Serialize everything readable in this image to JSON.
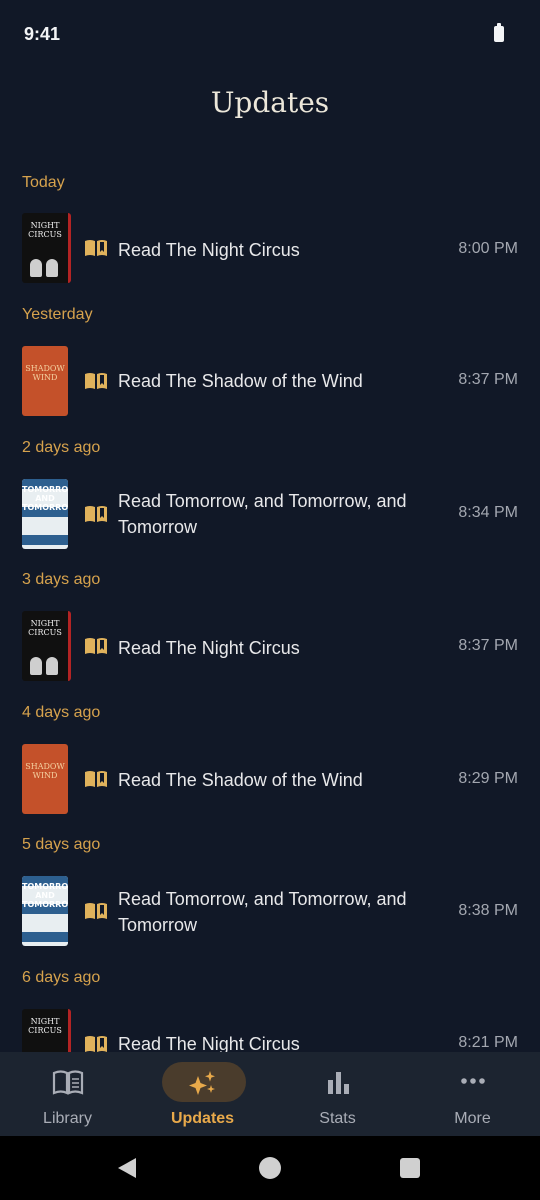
{
  "status_bar": {
    "time": "9:41"
  },
  "header": {
    "title": "Updates"
  },
  "cover_texts": {
    "night_circus": "NIGHT CIRCUS",
    "shadow_wind": "SHADOW WIND",
    "tomorrow": "TOMORROW AND TOMORROW"
  },
  "feed": [
    {
      "label": "Today",
      "entries": [
        {
          "text": "Read The Night Circus",
          "time": "8:00 PM",
          "cover": "night"
        }
      ]
    },
    {
      "label": "Yesterday",
      "entries": [
        {
          "text": "Read The Shadow of the Wind",
          "time": "8:37 PM",
          "cover": "shadow"
        }
      ]
    },
    {
      "label": "2 days ago",
      "entries": [
        {
          "text": "Read Tomorrow, and Tomorrow, and Tomorrow",
          "time": "8:34 PM",
          "cover": "tomorrow"
        }
      ]
    },
    {
      "label": "3 days ago",
      "entries": [
        {
          "text": "Read The Night Circus",
          "time": "8:37 PM",
          "cover": "night"
        }
      ]
    },
    {
      "label": "4 days ago",
      "entries": [
        {
          "text": "Read The Shadow of the Wind",
          "time": "8:29 PM",
          "cover": "shadow"
        }
      ]
    },
    {
      "label": "5 days ago",
      "entries": [
        {
          "text": "Read Tomorrow, and Tomorrow, and Tomorrow",
          "time": "8:38 PM",
          "cover": "tomorrow"
        }
      ]
    },
    {
      "label": "6 days ago",
      "entries": [
        {
          "text": "Read The Night Circus",
          "time": "8:21 PM",
          "cover": "night"
        }
      ]
    }
  ],
  "bottom_nav": {
    "items": [
      {
        "label": "Library",
        "icon": "book-open-icon"
      },
      {
        "label": "Updates",
        "icon": "sparkles-icon",
        "active": true
      },
      {
        "label": "Stats",
        "icon": "bar-chart-icon"
      },
      {
        "label": "More",
        "icon": "more-dots-icon"
      }
    ]
  },
  "colors": {
    "background": "#111827",
    "accent": "#d6a24d",
    "nav_background": "#1c2430",
    "active_pill": "#4a3c2c"
  }
}
